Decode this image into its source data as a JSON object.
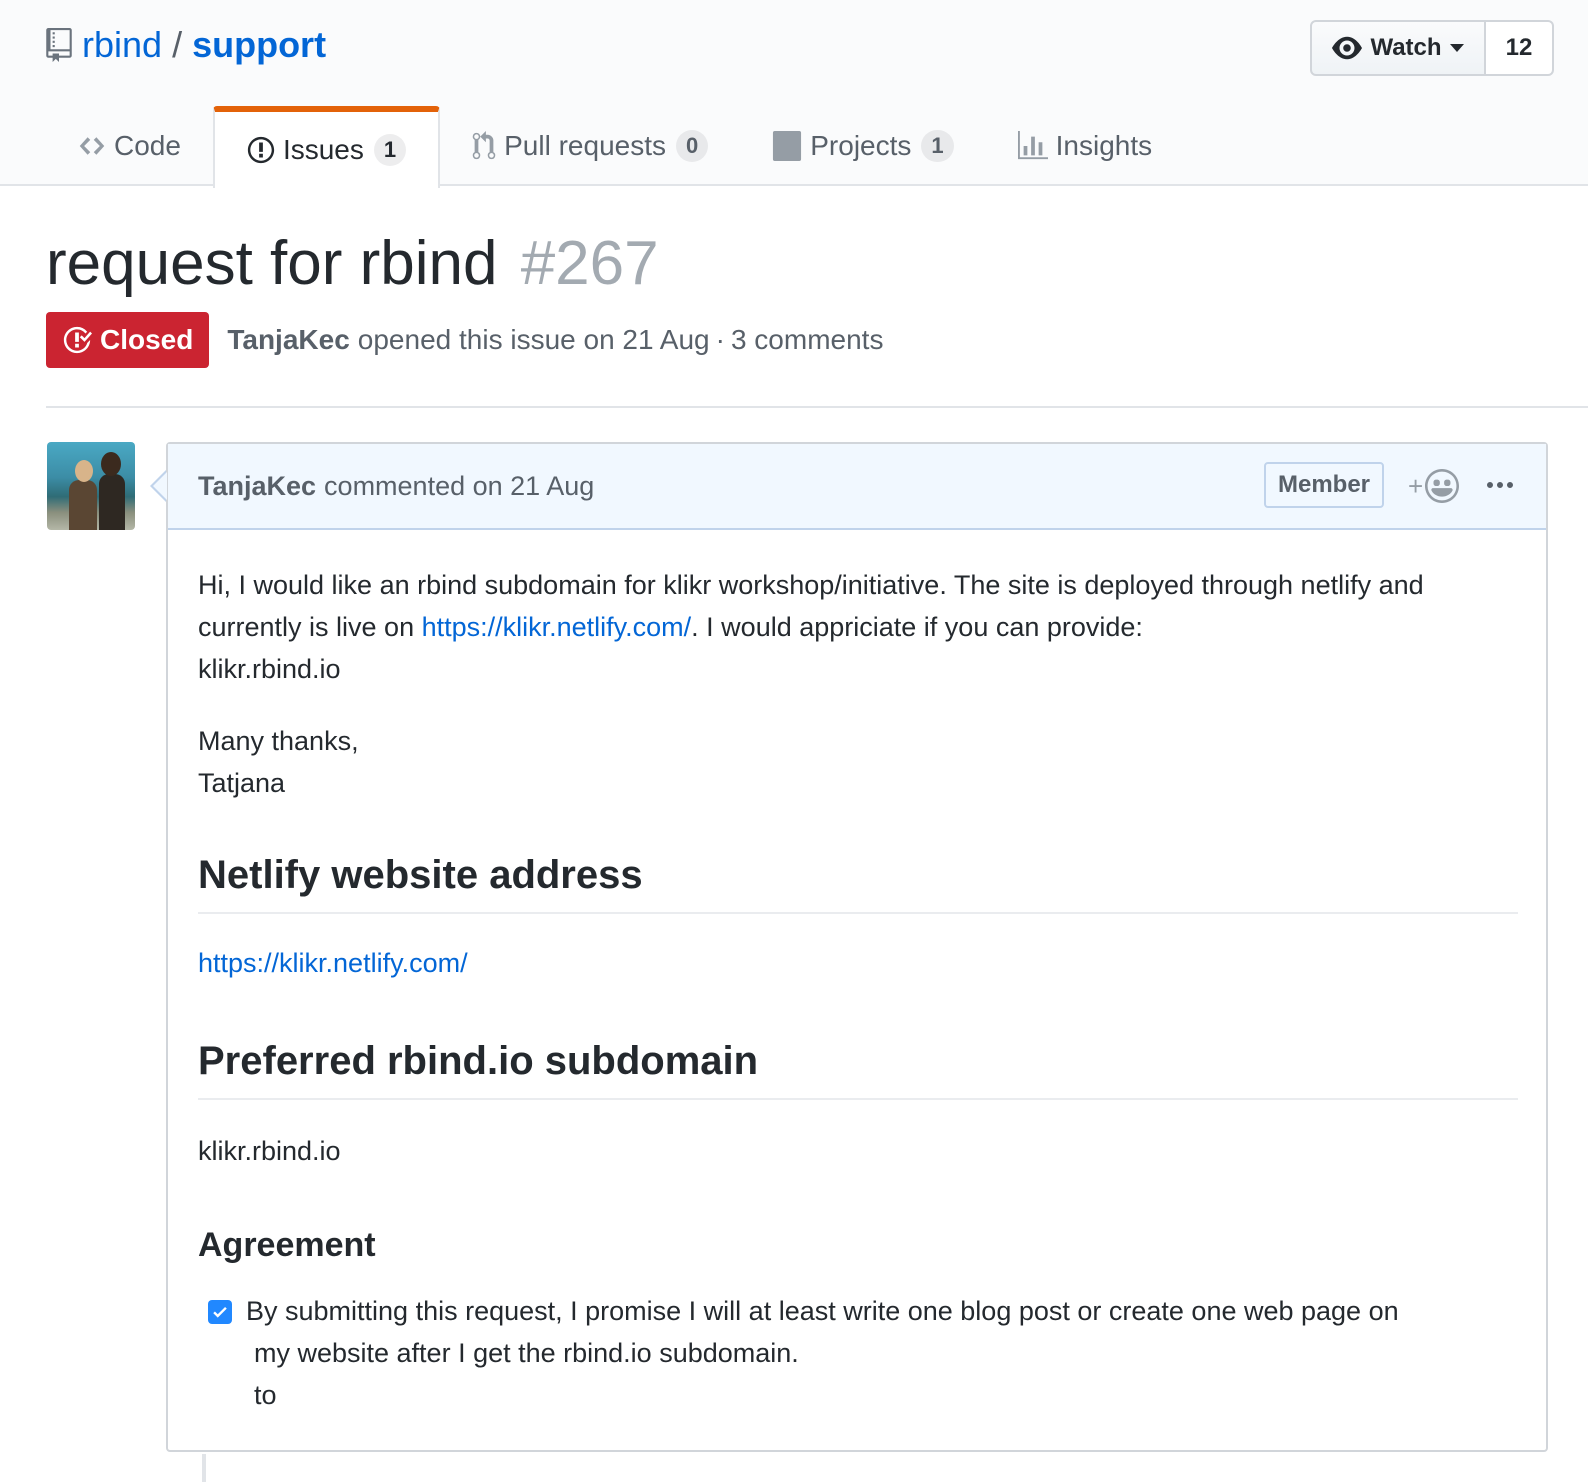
{
  "repo": {
    "owner": "rbind",
    "separator": "/",
    "name": "support",
    "icon": "repo-icon",
    "watch": {
      "label": "Watch",
      "count": "12",
      "icon": "eye-icon"
    }
  },
  "tabs": [
    {
      "label": "Code",
      "icon": "code-icon",
      "counter": null,
      "selected": false
    },
    {
      "label": "Issues",
      "icon": "issue-opened-icon",
      "counter": "1",
      "selected": true
    },
    {
      "label": "Pull requests",
      "icon": "git-pull-request-icon",
      "counter": "0",
      "selected": false
    },
    {
      "label": "Projects",
      "icon": "project-icon",
      "counter": "1",
      "selected": false
    },
    {
      "label": "Insights",
      "icon": "graph-icon",
      "counter": null,
      "selected": false
    }
  ],
  "issue": {
    "title": "request for rbind",
    "number": "#267",
    "state": "Closed",
    "state_color": "#cb2431",
    "author": "TanjaKec",
    "opened_text": "opened this issue on 21 Aug",
    "dot": "·",
    "comments_count": "3 comments"
  },
  "comment": {
    "author": "TanjaKec",
    "action": "commented on 21 Aug",
    "badge": "Member",
    "reaction": "+",
    "more_icon": "kebab-horizontal-icon",
    "body": {
      "p1_before": "Hi, I would like an rbind subdomain for klikr workshop/initiative. The site is deployed through netlify and currently is live on ",
      "p1_link": "https://klikr.netlify.com/",
      "p1_after": ". I would appriciate if you can provide:",
      "p1_line3": "klikr.rbind.io",
      "p2_line1": "Many thanks,",
      "p2_line2": "Tatjana",
      "h_netlify": "Netlify website address",
      "netlify_url": "https://klikr.netlify.com/",
      "h_pref": "Preferred rbind.io subdomain",
      "subdomain": "klikr.rbind.io",
      "h_agree": "Agreement",
      "task_line1": "By submitting this request, I promise I will at least write one blog post or create one web page on",
      "task_line2": "my website after I get the rbind.io subdomain.",
      "task_line3": "to",
      "task_checked": true
    }
  },
  "colors": {
    "link": "#0366d6",
    "accent_tab": "#e36209",
    "closed": "#cb2431",
    "comment_header": "#f1f8ff",
    "checkbox": "#2188ff"
  }
}
